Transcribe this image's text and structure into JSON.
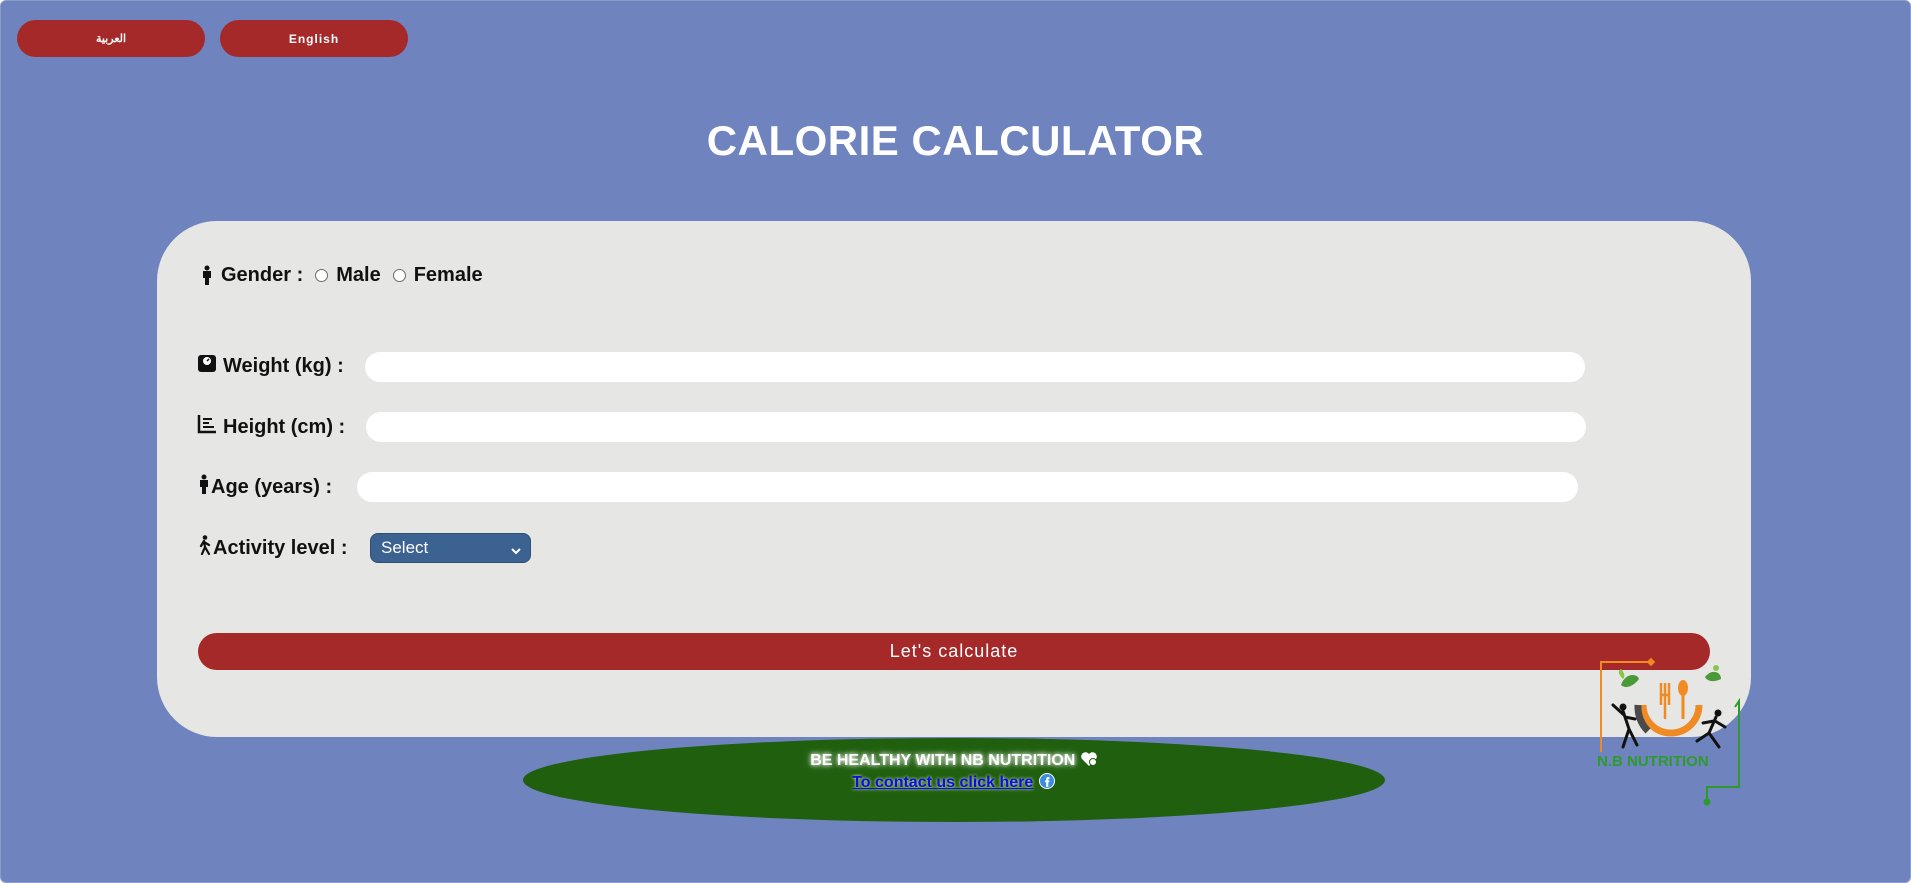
{
  "languages": {
    "arabic_label": "العربية",
    "english_label": "English"
  },
  "page_title": "CALORIE CALCULATOR",
  "form": {
    "gender_label": "Gender :",
    "gender_options": [
      "Male",
      "Female"
    ],
    "weight_label": "Weight (kg) :",
    "weight_value": "",
    "height_label": "Height (cm) :",
    "height_value": "",
    "age_label": "Age (years) :",
    "age_value": "",
    "activity_label": "Activity level :",
    "activity_selected": "Select",
    "submit_label": "Let's calculate"
  },
  "footer": {
    "slogan": "BE HEALTHY WITH NB NUTRITION",
    "contact_link": "To contact us click here"
  },
  "logo": {
    "text": "N.B NUTRITION"
  },
  "icons": {
    "gender": "person-standing-icon",
    "weight": "scale-icon",
    "height": "ruler-icon",
    "age": "child-icon",
    "activity": "person-walking-icon",
    "heart": "heart-icon",
    "facebook": "facebook-icon",
    "select": "chevron-down-icon"
  },
  "colors": {
    "background": "#6f84bf",
    "card": "#e6e7e5",
    "button": "#a6292a",
    "select": "#3b6291",
    "footer": "#1f5f0e",
    "logo_green": "#2d9a2c",
    "logo_orange": "#f08a24"
  }
}
